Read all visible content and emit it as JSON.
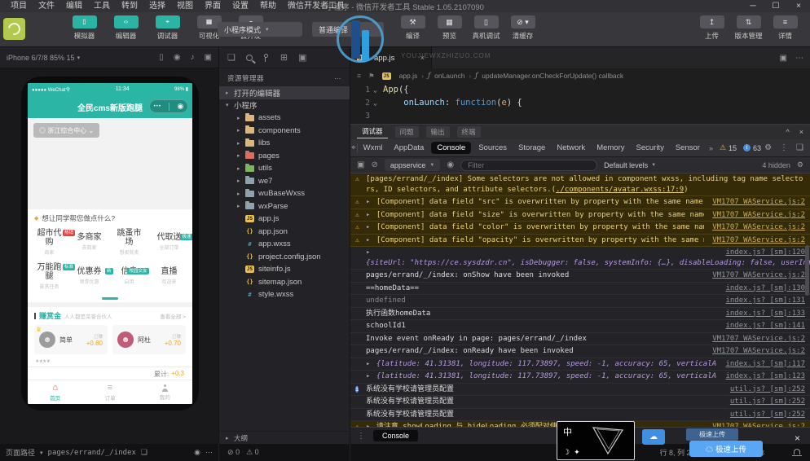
{
  "window": {
    "menus": [
      "项目",
      "文件",
      "编辑",
      "工具",
      "转到",
      "选择",
      "视图",
      "界面",
      "设置",
      "帮助",
      "微信开发者工具"
    ],
    "title": "小程序 - 微信开发者工具 Stable 1.05.2107090",
    "controls": {
      "minimize": "─",
      "maximize": "☐",
      "close": "×"
    }
  },
  "toolbar": {
    "panel_buttons": [
      {
        "label": "模拟器",
        "icon": "phone",
        "glyph": "▯",
        "active": true
      },
      {
        "label": "编辑器",
        "icon": "code",
        "glyph": "‹›",
        "active": true
      },
      {
        "label": "调试器",
        "icon": "debug",
        "glyph": "⌖",
        "active": true
      },
      {
        "label": "可视化",
        "icon": "visualize",
        "glyph": "▦",
        "active": false
      },
      {
        "label": "云开发",
        "icon": "cloud",
        "glyph": "☁",
        "active": false
      }
    ],
    "mode_select": "小程序模式",
    "compile_select": "普通编译",
    "action_buttons": [
      {
        "label": "编译",
        "icon": "compile",
        "glyph": "⚒"
      },
      {
        "label": "预览",
        "icon": "preview",
        "glyph": "▦"
      },
      {
        "label": "真机调试",
        "icon": "device-debug",
        "glyph": "▯"
      },
      {
        "label": "清缓存",
        "icon": "clear-cache",
        "glyph": "⊘ ▾"
      }
    ],
    "right_buttons": [
      {
        "label": "上传",
        "icon": "upload",
        "glyph": "↥"
      },
      {
        "label": "版本管理",
        "icon": "version",
        "glyph": "⇅"
      },
      {
        "label": "详情",
        "icon": "details",
        "glyph": "≡"
      }
    ]
  },
  "simulator": {
    "device_info": "iPhone 6/7/8 85% 15",
    "phone": {
      "status": {
        "carrier": "●●●●● WeChat令",
        "time": "11:34",
        "battery": "98% ▮"
      },
      "nav_title": "全民cms新版跑腿",
      "capsule": {
        "dots": "•••",
        "circle": "◉"
      },
      "location": "◎ 浙江综合中心 ⌄",
      "ask": "想让同学帮您做点什么?",
      "grid": [
        {
          "name": "超市代购",
          "badge": "热销",
          "badge_color": "#e64340",
          "sub": "商家"
        },
        {
          "name": "多商家",
          "badge": "",
          "badge_color": "",
          "sub": "去商家"
        },
        {
          "name": "跳蚤市场",
          "badge": "",
          "badge_color": "",
          "sub": "想卖就卖"
        },
        {
          "name": "代取送",
          "badge": "极速",
          "badge_color": "#2bb5a4",
          "sub": "全部订单"
        },
        {
          "name": "万能跑腿",
          "badge": "标准",
          "badge_color": "#2bb5a4",
          "sub": "悬赏任务"
        },
        {
          "name": "优惠券",
          "badge": "新",
          "badge_color": "#2bb5a4",
          "sub": "领劵优惠"
        },
        {
          "name": "信息",
          "badge": "校园交友",
          "badge_color": "#2bb5a4",
          "sub": "启用"
        },
        {
          "name": "直播",
          "badge": "",
          "badge_color": "",
          "sub": "欢迎来"
        }
      ],
      "reward": {
        "title": "赚赏金",
        "subtitle": "人人都是荣誉合伙人",
        "more": "查看全部 >",
        "users": [
          {
            "name": "简单",
            "label": "已赚",
            "amount": "+0.80"
          },
          {
            "name": "阿杜",
            "label": "已赚",
            "amount": "+0.70"
          }
        ],
        "stars": "****",
        "total_label": "累计:",
        "total_value": "+0.3"
      },
      "tabbar": [
        {
          "label": "首页",
          "active": true
        },
        {
          "label": "订单",
          "active": false
        },
        {
          "label": "我的",
          "active": false
        }
      ]
    }
  },
  "explorer": {
    "panel_title": "资源管理器",
    "kebab": "⋯",
    "sections": [
      {
        "label": "打开的编辑器"
      },
      {
        "label": "小程序"
      }
    ],
    "tree": [
      {
        "name": "assets",
        "type": "folder",
        "color": "#dcb67a"
      },
      {
        "name": "components",
        "type": "folder",
        "color": "#dcb67a"
      },
      {
        "name": "libs",
        "type": "folder",
        "color": "#dcb67a"
      },
      {
        "name": "pages",
        "type": "folder",
        "color": "#e06b5f"
      },
      {
        "name": "utils",
        "type": "folder",
        "color": "#7cb65c"
      },
      {
        "name": "we7",
        "type": "folder",
        "color": "#8fa3ad"
      },
      {
        "name": "wuBaseWxss",
        "type": "folder",
        "color": "#8fa3ad"
      },
      {
        "name": "wxParse",
        "type": "folder",
        "color": "#8fa3ad"
      },
      {
        "name": "app.js",
        "type": "js"
      },
      {
        "name": "app.json",
        "type": "json"
      },
      {
        "name": "app.wxss",
        "type": "wxss"
      },
      {
        "name": "project.config.json",
        "type": "json"
      },
      {
        "name": "siteinfo.js",
        "type": "js"
      },
      {
        "name": "sitemap.json",
        "type": "json"
      },
      {
        "name": "style.wxss",
        "type": "wxss"
      }
    ],
    "outline_label": "大纲",
    "problems": {
      "errors": "0",
      "warnings": "0"
    }
  },
  "editor": {
    "tab_label": "app.js",
    "watermark": "YOUJIEWXZHIZUO.COM",
    "breadcrumb": [
      "app.js",
      "onLaunch",
      "updateManager.onCheckForUpdate() callback"
    ],
    "code": [
      {
        "n": "1",
        "fold": true,
        "segs": [
          [
            "App",
            "fn"
          ],
          [
            "({",
            "pl"
          ]
        ]
      },
      {
        "n": "2",
        "fold": true,
        "segs": [
          [
            "    ",
            ""
          ],
          [
            "onLaunch",
            "prop"
          ],
          [
            ": ",
            "pl"
          ],
          [
            "function",
            "kw"
          ],
          [
            "(",
            "pl"
          ],
          [
            "e",
            "param"
          ],
          [
            ") {",
            "pl"
          ]
        ]
      },
      {
        "n": "3",
        "fold": false,
        "segs": []
      }
    ]
  },
  "devtools": {
    "window_tabs": [
      {
        "label": "调试器",
        "active": true
      },
      {
        "label": "问题",
        "active": false
      },
      {
        "label": "输出",
        "active": false
      },
      {
        "label": "终端",
        "active": false
      }
    ],
    "tabs": [
      {
        "label": "Wxml",
        "active": false
      },
      {
        "label": "AppData",
        "active": false
      },
      {
        "label": "Console",
        "active": true
      },
      {
        "label": "Sources",
        "active": false
      },
      {
        "label": "Storage",
        "active": false
      },
      {
        "label": "Network",
        "active": false
      },
      {
        "label": "Memory",
        "active": false
      },
      {
        "label": "Security",
        "active": false
      },
      {
        "label": "Sensor",
        "active": false
      }
    ],
    "overflow": "»",
    "warn_count": "15",
    "info_count": "63",
    "context": "appservice",
    "filter_placeholder": "Filter",
    "levels": "Default levels",
    "hidden_label": "4 hidden",
    "messages": [
      {
        "kind": "warn",
        "wrap": true,
        "text": "[pages/errand/_/index] Some selectors are not allowed in component wxss, including tag name selectors, ID selectors, and attribute selectors.(",
        "link": "./components/avatar.wxss:17:9",
        "text2": ")",
        "source": ""
      },
      {
        "kind": "warn",
        "chevron": true,
        "text": "[Component] data field \"src\" is overwritten by property with the same name.",
        "source": "VM1707 WAService.js:2"
      },
      {
        "kind": "warn",
        "chevron": true,
        "text": "[Component] data field \"size\" is overwritten by property with the same name.",
        "source": "VM1707 WAService.js:2"
      },
      {
        "kind": "warn",
        "chevron": true,
        "text": "[Component] data field \"color\" is overwritten by property with the same name.",
        "source": "VM1707 WAService.js:2"
      },
      {
        "kind": "warn",
        "chevron": true,
        "text": "[Component] data field \"opacity\" is overwritten by property with the same name.",
        "source": "VM1707 WAService.js:2"
      },
      {
        "kind": "log",
        "chevron": true,
        "objstyle": true,
        "srcline": true,
        "text": "{siteUrl: \"https://ce.sysdzdr.cn\", isDebugger: false, systemInfo: {…}, disableLoading: false, userInfo: null, …}",
        "source": "index.js? [sm]:120"
      },
      {
        "kind": "log",
        "text": "pages/errand/_/index: onShow have been invoked",
        "source": "VM1707 WAService.js:2"
      },
      {
        "kind": "log",
        "text": "==homeData==",
        "source": "index.js? [sm]:130"
      },
      {
        "kind": "log",
        "dim": true,
        "text": "undefined",
        "source": "index.js? [sm]:131"
      },
      {
        "kind": "log",
        "text": "执行函数homeData",
        "source": "index.js? [sm]:133"
      },
      {
        "kind": "log",
        "text": "schoolId1",
        "source": "index.js? [sm]:141"
      },
      {
        "kind": "log",
        "text": "Invoke event onReady in page: pages/errand/_/index",
        "source": "VM1707 WAService.js:2"
      },
      {
        "kind": "log",
        "text": "pages/errand/_/index: onReady have been invoked",
        "source": "VM1707 WAService.js:2"
      },
      {
        "kind": "log",
        "chevron": true,
        "objstyle": true,
        "text": "{latitude: 41.31381, longitude: 117.73897, speed: -1, accuracy: 65, verticalAccuracy: 65, …}",
        "source": "index.js? [sm]:117"
      },
      {
        "kind": "log",
        "chevron": true,
        "objstyle": true,
        "text": "{latitude: 41.31381, longitude: 117.73897, speed: -1, accuracy: 65, verticalAccuracy: 65, …}",
        "source": "index.js? [sm]:123"
      },
      {
        "kind": "info",
        "text": "系统没有学校请管理员配置",
        "source": "util.js? [sm]:252"
      },
      {
        "kind": "log",
        "text": "系统没有学校请管理员配置",
        "source": "util.js? [sm]:252"
      },
      {
        "kind": "log",
        "text": "系统没有学校请管理员配置",
        "source": "util.js? [sm]:252"
      },
      {
        "kind": "warn",
        "chevron": true,
        "text": "请注意 showLoading 与 hideLoading 必须配对使用",
        "source": "VM1707 WAService.js:2"
      }
    ],
    "prompt": "›",
    "console_drawer_label": "Console"
  },
  "statusbar": {
    "path_label": "页面路径",
    "path": "pages/errand/_/index",
    "line_col": "行 8, 列 27",
    "spaces": "空格: 2",
    "encoding": "UTF-8"
  },
  "overlay": {
    "char": "中",
    "moon": "☽",
    "star": "✦"
  },
  "upload": {
    "button_label": "极速上传",
    "tooltip": "☁ 极速上传"
  },
  "colors": {
    "accent": "#2bb5a4",
    "warn": "#e8b33a",
    "orange": "#f5a623",
    "blue": "#4a90e2"
  }
}
